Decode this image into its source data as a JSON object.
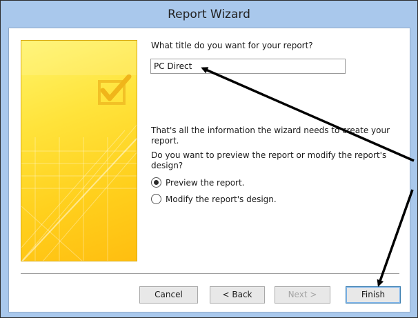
{
  "window": {
    "title": "Report Wizard"
  },
  "prompt": {
    "title_question": "What title do you want for your report?"
  },
  "title_field": {
    "value": "PC Direct"
  },
  "info": {
    "line1": "That's all the information the wizard needs to create your",
    "line2": "report.",
    "line3": "Do you want to preview the report or modify the report's",
    "line4": "design?"
  },
  "options": [
    {
      "label": "Preview the report.",
      "selected": true
    },
    {
      "label": "Modify the report's design.",
      "selected": false
    }
  ],
  "buttons": {
    "cancel": "Cancel",
    "back": "< Back",
    "next": "Next >",
    "finish": "Finish"
  },
  "colors": {
    "window_frame": "#a9c8ec",
    "banner": "#ffe33b",
    "annotation_arrow": "#000000"
  }
}
